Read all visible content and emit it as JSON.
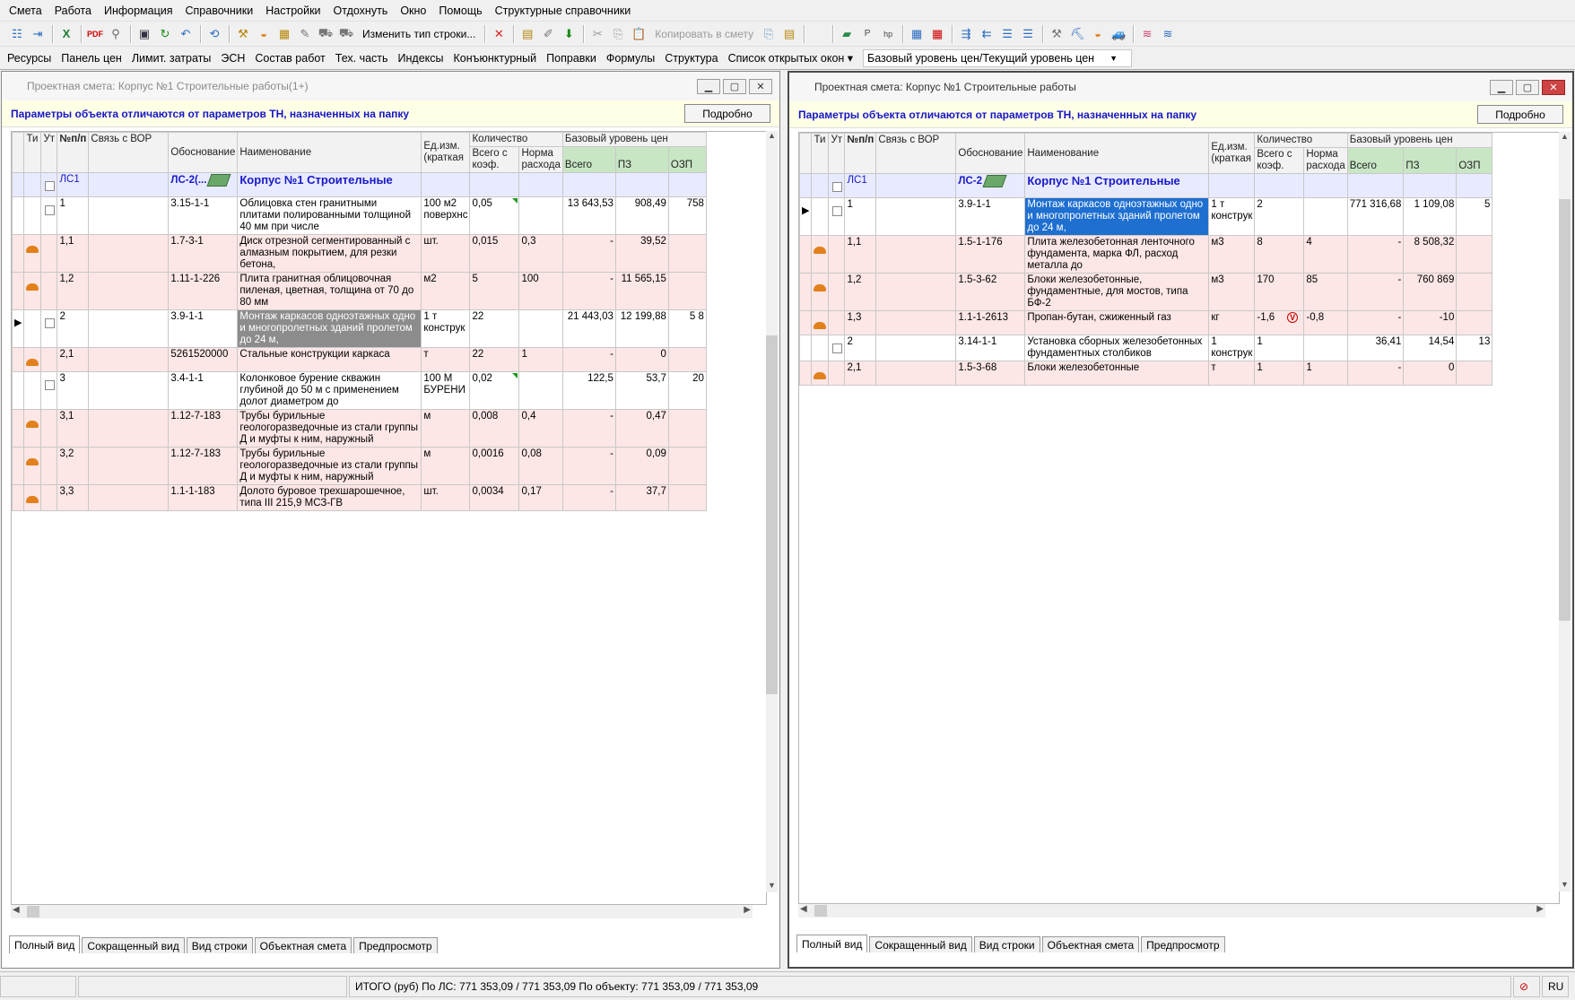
{
  "menu": [
    "Смета",
    "Работа",
    "Информация",
    "Справочники",
    "Настройки",
    "Отдохнуть",
    "Окно",
    "Помощь",
    "Структурные справочники"
  ],
  "toolbar": {
    "change_row_type": "Изменить тип строки...",
    "copy_to_estimate": "Копировать в смету"
  },
  "toolbar2": {
    "items": [
      "Ресурсы",
      "Панель цен",
      "Лимит. затраты",
      "ЭСН",
      "Состав работ",
      "Тех. часть",
      "Индексы",
      "Конъюнктурный",
      "Поправки",
      "Формулы",
      "Структура",
      "Список открытых окон ▾"
    ],
    "price_level": "Базовый уровень цен/Текущий уровень цен"
  },
  "headers": {
    "ti": "Ти",
    "ut": "Ут",
    "num": "№п/п",
    "vor": "Связь с ВОР",
    "osn": "Обоснование",
    "name": "Наименование",
    "unit": "Ед.изм. (краткая",
    "qty": "Количество",
    "qty_total": "Всего с коэф.",
    "qty_norm": "Норма расхода",
    "base": "Базовый уровень цен",
    "total": "Всего",
    "pz": "ПЗ",
    "ozp": "ОЗП"
  },
  "left": {
    "title": "Проектная смета: Корпус №1 Строительные работы(1+)",
    "warning": "Параметры объекта отличаются от параметров ТН, назначенных на папку",
    "details_btn": "Подробно",
    "group": {
      "num": "ЛС1",
      "osn": "ЛС-2(...",
      "name": "Корпус №1 Строительные"
    },
    "rows": [
      {
        "type": "wt",
        "mark": "",
        "cb": true,
        "num": "1",
        "osn": "3.15-1-1",
        "name": "Облицовка стен гранитными плитами полированными толщиной 40 мм при числе",
        "unit": "100 м2 поверхнс",
        "qty": "0,05",
        "norm": "",
        "total": "13 643,53",
        "pz": "908,49",
        "ozp": "758",
        "tri": true
      },
      {
        "type": "pk",
        "mark": "res",
        "cb": false,
        "num": "1,1",
        "osn": "1.7-3-1",
        "name": "Диск отрезной сегментированный с алмазным покрытием, для резки бетона,",
        "unit": "шт.",
        "qty": "0,015",
        "norm": "0,3",
        "total": "-",
        "pz": "39,52",
        "ozp": ""
      },
      {
        "type": "pk",
        "mark": "res",
        "cb": false,
        "num": "1,2",
        "osn": "1.11-1-226",
        "name": "Плита гранитная облицовочная пиленая, цветная, толщина от 70 до 80 мм",
        "unit": "м2",
        "qty": "5",
        "norm": "100",
        "total": "-",
        "pz": "11 565,15",
        "ozp": ""
      },
      {
        "type": "wt",
        "mark": "arrow",
        "cb": true,
        "num": "2",
        "osn": "3.9-1-1",
        "name": "Монтаж каркасов одноэтажных одно и многопролетных зданий пролетом до 24 м,",
        "unit": "1 т конструк",
        "qty": "22",
        "norm": "",
        "total": "21 443,03",
        "pz": "12 199,88",
        "ozp": "5 8",
        "hl": true
      },
      {
        "type": "pk",
        "mark": "res",
        "cb": false,
        "num": "2,1",
        "osn": "5261520000",
        "name": "Стальные конструкции каркаса",
        "unit": "т",
        "qty": "22",
        "norm": "1",
        "total": "-",
        "pz": "0",
        "ozp": ""
      },
      {
        "type": "wt",
        "mark": "",
        "cb": true,
        "num": "3",
        "osn": "3.4-1-1",
        "name": "Колонковое бурение скважин глубиной до 50 м с применением долот диаметром до",
        "unit": "100 М БУРЕНИ",
        "qty": "0,02",
        "norm": "",
        "total": "122,5",
        "pz": "53,7",
        "ozp": "20",
        "tri": true
      },
      {
        "type": "pk",
        "mark": "res",
        "cb": false,
        "num": "3,1",
        "osn": "1.12-7-183",
        "name": "Трубы бурильные геологоразведочные из стали группы Д и муфты к ним, наружный",
        "unit": "м",
        "qty": "0,008",
        "norm": "0,4",
        "total": "-",
        "pz": "0,47",
        "ozp": ""
      },
      {
        "type": "pk",
        "mark": "res",
        "cb": false,
        "num": "3,2",
        "osn": "1.12-7-183",
        "name": "Трубы бурильные геологоразведочные из стали группы Д и муфты к ним, наружный",
        "unit": "м",
        "qty": "0,0016",
        "norm": "0,08",
        "total": "-",
        "pz": "0,09",
        "ozp": ""
      },
      {
        "type": "pk",
        "mark": "res",
        "cb": false,
        "num": "3,3",
        "osn": "1.1-1-183",
        "name": "Долото буровое трехшарошечное, типа III 215,9 МСЗ-ГВ",
        "unit": "шт.",
        "qty": "0,0034",
        "norm": "0,17",
        "total": "-",
        "pz": "37,7",
        "ozp": ""
      }
    ],
    "tabs": [
      "Полный вид",
      "Сокращенный вид",
      "Вид строки",
      "Объектная смета",
      "Предпросмотр"
    ]
  },
  "right": {
    "title": "Проектная смета: Корпус №1 Строительные работы",
    "warning": "Параметры объекта отличаются от параметров ТН, назначенных на папку",
    "details_btn": "Подробно",
    "group": {
      "num": "ЛС1",
      "osn": "ЛС-2",
      "name": "Корпус №1 Строительные"
    },
    "rows": [
      {
        "type": "wt",
        "mark": "arrow",
        "cb": true,
        "num": "1",
        "osn": "3.9-1-1",
        "name": "Монтаж каркасов одноэтажных одно и многопролетных зданий пролетом до 24 м,",
        "unit": "1 т конструк",
        "qty": "2",
        "norm": "",
        "total": "771 316,68",
        "pz": "1 109,08",
        "ozp": "5",
        "sel": true
      },
      {
        "type": "pk",
        "mark": "res",
        "cb": false,
        "num": "1,1",
        "osn": "1.5-1-176",
        "name": "Плита железобетонная ленточного фундамента, марка ФЛ, расход металла до",
        "unit": "м3",
        "qty": "8",
        "norm": "4",
        "total": "-",
        "pz": "8 508,32",
        "ozp": ""
      },
      {
        "type": "pk",
        "mark": "res",
        "cb": false,
        "num": "1,2",
        "osn": "1.5-3-62",
        "name": "Блоки железобетонные, фундаментные, для мостов, типа БФ-2",
        "unit": "м3",
        "qty": "170",
        "norm": "85",
        "total": "-",
        "pz": "760 869",
        "ozp": ""
      },
      {
        "type": "pk",
        "mark": "res",
        "cb": false,
        "num": "1,3",
        "osn": "1.1-1-2613",
        "name": "Пропан-бутан, сжиженный газ",
        "unit": "кг",
        "qty": "-1,6",
        "norm": "-0,8",
        "total": "-",
        "pz": "-10",
        "ozp": "",
        "red": true
      },
      {
        "type": "wt",
        "mark": "",
        "cb": true,
        "num": "2",
        "osn": "3.14-1-1",
        "name": "Установка сборных железобетонных фундаментных столбиков",
        "unit": "1 конструк",
        "qty": "1",
        "norm": "",
        "total": "36,41",
        "pz": "14,54",
        "ozp": "13"
      },
      {
        "type": "pk",
        "mark": "res",
        "cb": false,
        "num": "2,1",
        "osn": "1.5-3-68",
        "name": "Блоки железобетонные",
        "unit": "т",
        "qty": "1",
        "norm": "1",
        "total": "-",
        "pz": "0",
        "ozp": ""
      }
    ],
    "tabs": [
      "Полный вид",
      "Сокращенный вид",
      "Вид строки",
      "Объектная смета",
      "Предпросмотр"
    ]
  },
  "status": {
    "total": "ИТОГО (руб)  По ЛС: 771 353,09 / 771 353,09     По объекту: 771 353,09 / 771 353,09",
    "lang": "RU"
  }
}
